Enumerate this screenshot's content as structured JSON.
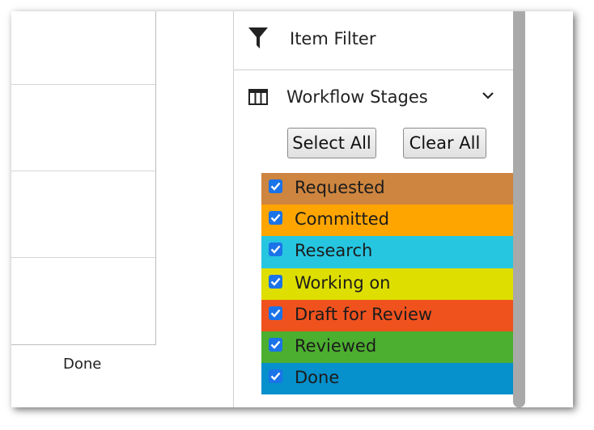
{
  "board": {
    "column_label": "Done"
  },
  "panel": {
    "filter_title": "Item Filter",
    "stages_title": "Workflow Stages",
    "select_all_label": "Select All",
    "clear_all_label": "Clear All",
    "stages": [
      {
        "label": "Requested",
        "color": "#cd853f",
        "checked": true
      },
      {
        "label": "Committed",
        "color": "#ffa500",
        "checked": true
      },
      {
        "label": "Research",
        "color": "#26c6e0",
        "checked": true
      },
      {
        "label": "Working on",
        "color": "#dede00",
        "checked": true
      },
      {
        "label": "Draft for Review",
        "color": "#f0521e",
        "checked": true
      },
      {
        "label": "Reviewed",
        "color": "#4caf2f",
        "checked": true
      },
      {
        "label": "Done",
        "color": "#0690cc",
        "checked": true
      }
    ]
  },
  "icons": {
    "filter": "funnel-icon",
    "stages": "columns-icon",
    "chevron": "chevron-down-icon",
    "check": "checkmark-icon"
  }
}
